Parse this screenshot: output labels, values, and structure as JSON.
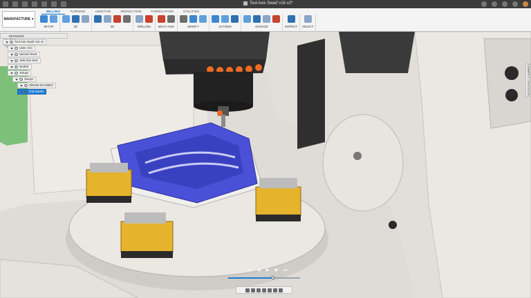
{
  "window": {
    "document_title": "Tool Axis Swarf v16 v2*"
  },
  "ribbon": {
    "workspace": "MANUFACTURE",
    "tabs": [
      "MILLING",
      "TURNING",
      "ADDITIVE",
      "INSPECTION",
      "FABRICATION",
      "UTILITIES"
    ],
    "active_tab": "MILLING",
    "groups": [
      {
        "label": "SETUP",
        "icons": [
          "setup-folder-icon",
          "setup-sheet-icon"
        ]
      },
      {
        "label": "2D",
        "icons": [
          "2d-adaptive-icon",
          "2d-pocket-icon",
          "face-icon"
        ]
      },
      {
        "label": "3D",
        "icons": [
          "3d-adaptive-icon",
          "3d-pocket-icon",
          "steep-shallow-icon",
          "flow-icon"
        ]
      },
      {
        "label": "DRILLING",
        "icons": [
          "drill-icon",
          "hole-recognition-icon"
        ]
      },
      {
        "label": "MULTI-AXIS",
        "icons": [
          "swarf-icon",
          "rotary-icon"
        ]
      },
      {
        "label": "MODIFY",
        "icons": [
          "scissors-icon",
          "delete-icon",
          "pin-icon"
        ]
      },
      {
        "label": "ACTIONS",
        "icons": [
          "simulate-icon",
          "post-process-icon",
          "generate-icon"
        ]
      },
      {
        "label": "MANAGE",
        "icons": [
          "tool-library-icon",
          "templates-icon",
          "machine-library-icon",
          "post-library-icon"
        ]
      },
      {
        "label": "INSPECT",
        "icons": [
          "measure-icon"
        ]
      },
      {
        "label": "SELECT",
        "icons": [
          "select-arrow-icon"
        ]
      }
    ]
  },
  "browser": {
    "header": "BROWSER",
    "items": [
      {
        "label": "Tool Axis Swarf v16 v2",
        "indent": 0,
        "selected": false
      },
      {
        "label": "Units: mm",
        "indent": 1,
        "selected": false
      },
      {
        "label": "Named Views",
        "indent": 1,
        "selected": false
      },
      {
        "label": "Selection Sets",
        "indent": 1,
        "selected": false
      },
      {
        "label": "Models",
        "indent": 1,
        "selected": false
      },
      {
        "label": "Setups",
        "indent": 1,
        "selected": false
      },
      {
        "label": "Setup1",
        "indent": 2,
        "selected": false
      },
      {
        "label": "DMU65 MU-8684V",
        "indent": 3,
        "selected": false
      },
      {
        "label": "[T2] Swarf1",
        "indent": 3,
        "selected": true
      }
    ]
  },
  "navbar": {
    "label": "COMMENTS / NAVIGATION"
  },
  "colors": {
    "accent": "#1c7bd4",
    "part": "#4a51d8",
    "machine_body": "#e4e1dc",
    "vise": "#e6b32c",
    "spindle": "#2c2c2c",
    "coolant": "#f16a22"
  },
  "timeline": {
    "buttons": [
      "first-icon",
      "previous-icon",
      "play-icon",
      "next-icon",
      "last-icon"
    ],
    "progress": 0.62
  },
  "bottom_toolbar": {
    "buttons": [
      "orbit-icon",
      "pan-icon",
      "zoom-icon",
      "fit-icon",
      "display-settings-icon",
      "grid-icon",
      "viewports-icon"
    ]
  }
}
